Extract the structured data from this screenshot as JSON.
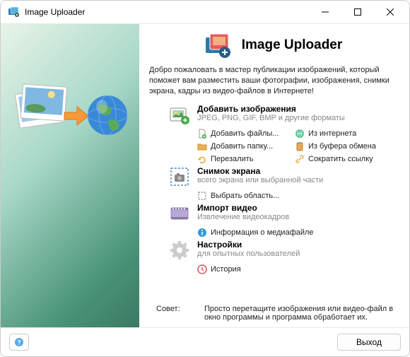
{
  "window": {
    "title": "Image Uploader",
    "header": "Image Uploader"
  },
  "welcome": "Добро пожаловать в мастер публикации изображений, который поможет вам разместить ваши фотографии, изображения, снимки экрана, кадры из видео-файлов в Интернете!",
  "sections": {
    "add_images": {
      "title": "Добавить изображения",
      "subtitle": "JPEG, PNG, GIF, BMP и другие форматы",
      "items": {
        "add_files": "Добавить файлы...",
        "from_internet": "Из интернета",
        "add_folder": "Добавить папку...",
        "from_clipboard": "Из буфера обмена",
        "reupload": "Перезалить",
        "shorten_link": "Сократить ссылку"
      }
    },
    "screenshot": {
      "title": "Снимок экрана",
      "subtitle": "всего экрана или выбранной части",
      "items": {
        "select_region": "Выбрать область..."
      }
    },
    "import_video": {
      "title": "Импорт видео",
      "subtitle": "Извлечение видеокадров",
      "items": {
        "media_info": "Информация о медиафайле"
      }
    },
    "settings": {
      "title": "Настройки",
      "subtitle": "для опытных пользователей",
      "items": {
        "history": "История"
      }
    }
  },
  "tip": {
    "label": "Совет:",
    "text": "Просто перетащите изображения или видео-файл в окно программы и программа обработает их."
  },
  "footer": {
    "exit": "Выход"
  },
  "colors": {
    "accent_blue": "#3399dd",
    "accent_green": "#44aa66",
    "folder": "#e8a23c"
  }
}
